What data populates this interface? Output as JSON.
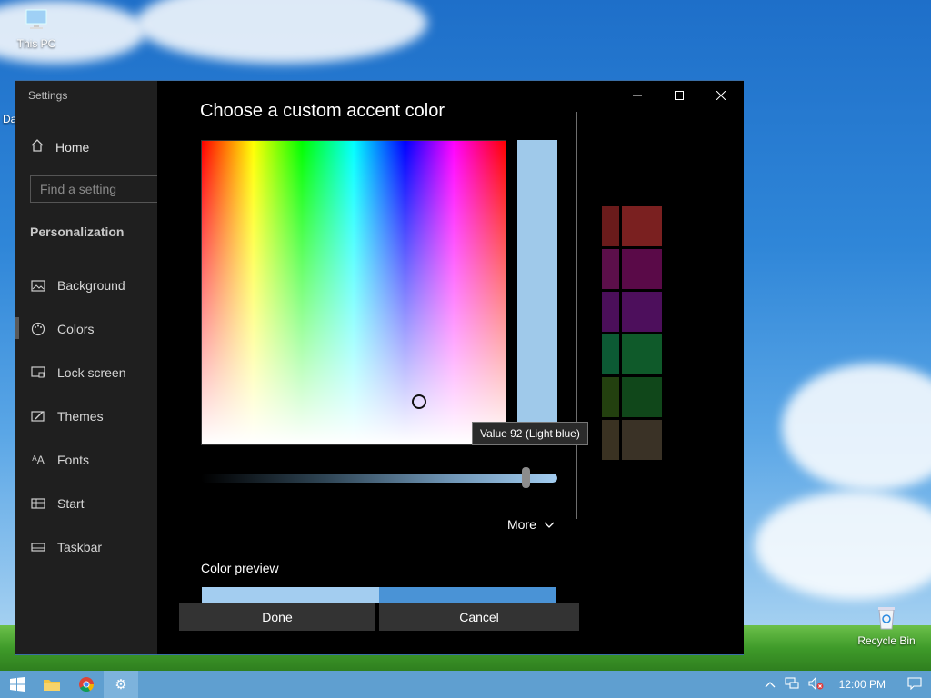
{
  "desktop": {
    "icons": [
      {
        "label": "This PC"
      },
      {
        "label": "Recycle Bin"
      }
    ],
    "clipped_label": "Da"
  },
  "window": {
    "app_title": "Settings",
    "home_label": "Home",
    "search_placeholder": "Find a setting",
    "section_title": "Personalization",
    "nav": [
      {
        "label": "Background",
        "icon": "picture-icon"
      },
      {
        "label": "Colors",
        "icon": "palette-icon"
      },
      {
        "label": "Lock screen",
        "icon": "lock-screen-icon"
      },
      {
        "label": "Themes",
        "icon": "themes-icon"
      },
      {
        "label": "Fonts",
        "icon": "fonts-icon"
      },
      {
        "label": "Start",
        "icon": "start-icon"
      },
      {
        "label": "Taskbar",
        "icon": "taskbar-icon"
      }
    ],
    "active_nav": "Colors",
    "swatches": [
      "#7a2020",
      "#5a0a48",
      "#4d0f5c",
      "#0f5a2a",
      "#10471a",
      "#3a3226"
    ]
  },
  "dialog": {
    "title": "Choose a custom accent color",
    "tooltip": "Value 92 (Light blue)",
    "slider_value": 92,
    "more_label": "More",
    "preview_label": "Color preview",
    "done_label": "Done",
    "cancel_label": "Cancel",
    "selected_color": "#9fc9ea",
    "preview_colors": [
      "#a3cdf0",
      "#4a93d6"
    ]
  },
  "taskbar": {
    "time": "12:00 PM",
    "apps": [
      "start-icon",
      "file-explorer-icon",
      "chrome-icon",
      "settings-icon"
    ]
  }
}
